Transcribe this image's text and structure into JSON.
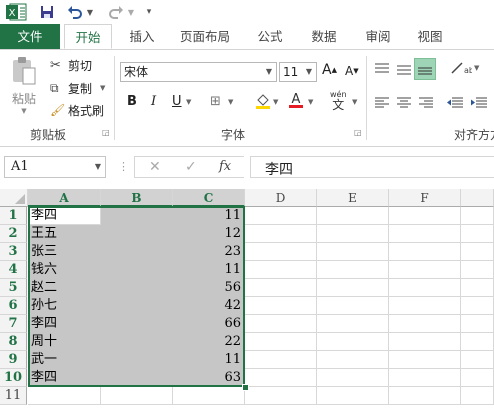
{
  "qat": {
    "excel_icon": "excel-logo-icon",
    "save_icon": "save-icon",
    "undo_icon": "undo-icon",
    "redo_icon": "redo-icon",
    "customize_icon": "customize-qat-icon"
  },
  "tabs": [
    {
      "label": "文件"
    },
    {
      "label": "开始"
    },
    {
      "label": "插入"
    },
    {
      "label": "页面布局"
    },
    {
      "label": "公式"
    },
    {
      "label": "数据"
    },
    {
      "label": "审阅"
    },
    {
      "label": "视图"
    }
  ],
  "ribbon": {
    "clipboard": {
      "paste": "粘贴",
      "cut": "剪切",
      "copy": "复制",
      "format_painter": "格式刷",
      "group_label": "剪贴板"
    },
    "font": {
      "name": "宋体",
      "size": "11",
      "bold": "B",
      "italic": "I",
      "underline": "U",
      "grow": "A",
      "shrink": "A",
      "wen": "wén",
      "wen_char": "文",
      "group_label": "字体"
    },
    "alignment": {
      "group_label": "对齐方方"
    }
  },
  "formula_bar": {
    "name_box": "A1",
    "fx": "fx",
    "value": "李四"
  },
  "grid": {
    "columns": [
      "A",
      "B",
      "C",
      "D",
      "E",
      "F"
    ],
    "rows": [
      {
        "num": "1",
        "a": "李四",
        "c": "11"
      },
      {
        "num": "2",
        "a": "王五",
        "c": "12"
      },
      {
        "num": "3",
        "a": "张三",
        "c": "23"
      },
      {
        "num": "4",
        "a": "钱六",
        "c": "11"
      },
      {
        "num": "5",
        "a": "赵二",
        "c": "56"
      },
      {
        "num": "6",
        "a": "孙七",
        "c": "42"
      },
      {
        "num": "7",
        "a": "李四",
        "c": "66"
      },
      {
        "num": "8",
        "a": "周十",
        "c": "22"
      },
      {
        "num": "9",
        "a": "武一",
        "c": "11"
      },
      {
        "num": "10",
        "a": "李四",
        "c": "63"
      },
      {
        "num": "11",
        "a": "",
        "c": ""
      }
    ]
  },
  "colors": {
    "accent": "#217346",
    "selection": "#c6c6c6"
  }
}
